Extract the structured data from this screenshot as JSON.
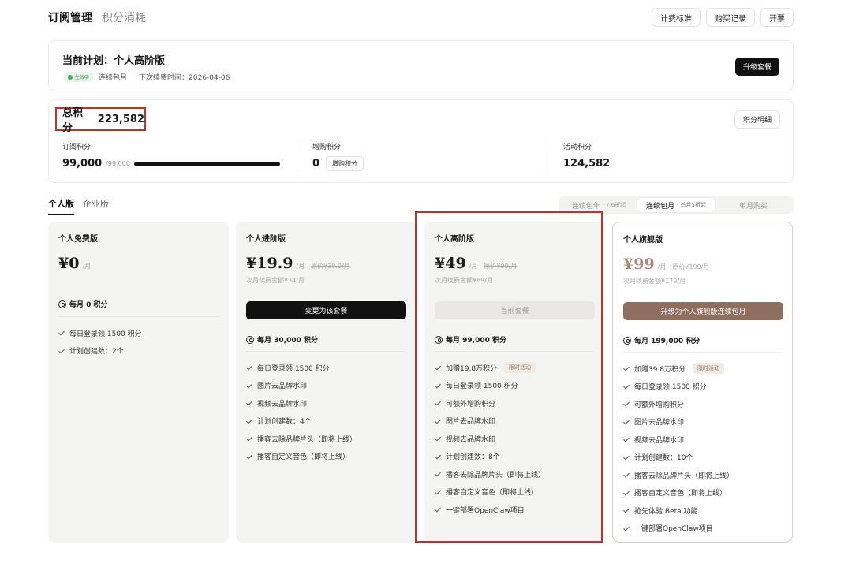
{
  "header": {
    "tabs": [
      "订阅管理",
      "积分消耗"
    ],
    "buttons": [
      "计费标准",
      "购买记录",
      "开票"
    ]
  },
  "current_plan": {
    "title": "当前计划：个人高阶版",
    "status": "生效中",
    "billing_mode": "连续包月",
    "next_renewal": "下次续费时间：2026-04-06",
    "upgrade_label": "升级套餐",
    "status_color": "#3bb05a"
  },
  "points": {
    "total_label": "总积分",
    "total_value": "223,582",
    "detail_label": "积分明细",
    "subscription": {
      "label": "订阅积分",
      "value": "99,000",
      "of": "/99,000",
      "fill_fraction": 1.0
    },
    "purchased": {
      "label": "增购积分",
      "value": "0",
      "button": "增购积分"
    },
    "activity": {
      "label": "活动积分",
      "value": "124,582"
    }
  },
  "plan_tabs": [
    "个人版",
    "企业版"
  ],
  "billing_options": [
    {
      "label": "连续包年",
      "tag": "· 7.6折起"
    },
    {
      "label": "连续包月",
      "tag": "· 首月5折起"
    },
    {
      "label": "单月购买",
      "tag": ""
    }
  ],
  "plans": [
    {
      "name": "个人免费版",
      "price": "¥0",
      "per": "/月",
      "original": "",
      "renew": "",
      "cta": "",
      "quota": "每月 0 积分",
      "features": [
        {
          "text": "每日登录领 1500 积分",
          "tag": ""
        },
        {
          "text": "计划创建数：2个",
          "tag": ""
        }
      ]
    },
    {
      "name": "个人进阶版",
      "price": "¥19.9",
      "per": "/月",
      "original": "原价¥39.9/月",
      "renew": "次月续费金额¥34/月",
      "cta": "变更为该套餐",
      "quota": "每月 30,000 积分",
      "features": [
        {
          "text": "每日登录领 1500 积分",
          "tag": ""
        },
        {
          "text": "图片去品牌水印",
          "tag": ""
        },
        {
          "text": "视频去品牌水印",
          "tag": ""
        },
        {
          "text": "计划创建数：4个",
          "tag": ""
        },
        {
          "text": "播客去除品牌片头（即将上线）",
          "tag": ""
        },
        {
          "text": "播客自定义音色（即将上线）",
          "tag": ""
        }
      ]
    },
    {
      "name": "个人高阶版",
      "price": "¥49",
      "per": "/月",
      "original": "原价¥99/月",
      "renew": "次月续费金额¥89/月",
      "cta": "当前套餐",
      "quota": "每月 99,000 积分",
      "features": [
        {
          "text": "加赠19.8万积分",
          "tag": "限时活动"
        },
        {
          "text": "每日登录领 1500 积分",
          "tag": ""
        },
        {
          "text": "可额外增购积分",
          "tag": ""
        },
        {
          "text": "图片去品牌水印",
          "tag": ""
        },
        {
          "text": "视频去品牌水印",
          "tag": ""
        },
        {
          "text": "计划创建数：8个",
          "tag": ""
        },
        {
          "text": "播客去除品牌片头（即将上线）",
          "tag": ""
        },
        {
          "text": "播客自定义音色（即将上线）",
          "tag": ""
        },
        {
          "text": "一键部署OpenClaw项目",
          "tag": ""
        }
      ]
    },
    {
      "name": "个人旗舰版",
      "price": "¥99",
      "per": "/月",
      "original": "原价¥199/月",
      "renew": "次月续费金额¥179/月",
      "cta": "升级为个人旗舰版连续包月",
      "quota": "每月 199,000 积分",
      "features": [
        {
          "text": "加赠39.8万积分",
          "tag": "限时活动"
        },
        {
          "text": "每日登录领 1500 积分",
          "tag": ""
        },
        {
          "text": "可额外增购积分",
          "tag": ""
        },
        {
          "text": "图片去品牌水印",
          "tag": ""
        },
        {
          "text": "视频去品牌水印",
          "tag": ""
        },
        {
          "text": "计划创建数：10个",
          "tag": ""
        },
        {
          "text": "播客去除品牌片头（即将上线）",
          "tag": ""
        },
        {
          "text": "播客自定义音色（即将上线）",
          "tag": ""
        },
        {
          "text": "抢先体验 Beta 功能",
          "tag": ""
        },
        {
          "text": "一键部署OpenClaw项目",
          "tag": ""
        }
      ]
    }
  ],
  "colors": {
    "highlight_outline": "#c0322b",
    "brand_brown": "#8d6e5f"
  }
}
